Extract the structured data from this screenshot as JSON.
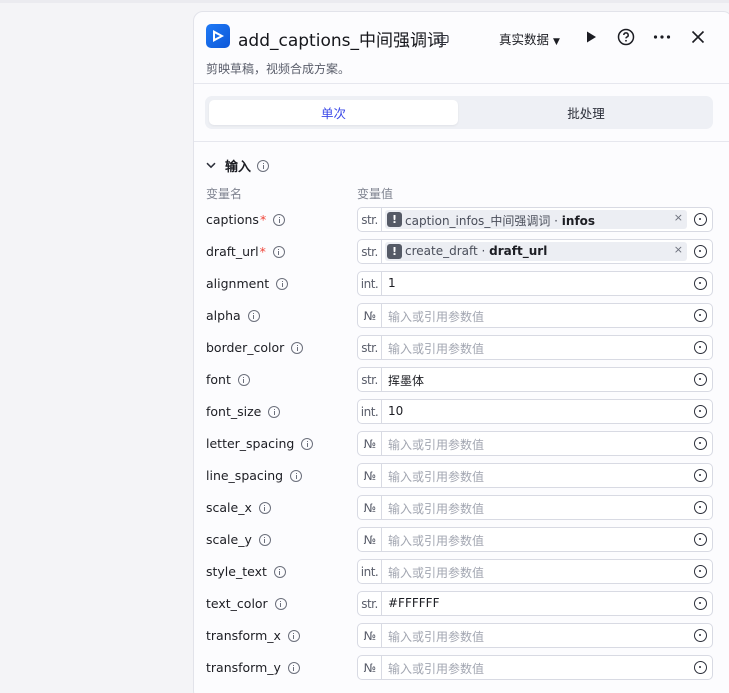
{
  "header": {
    "title": "add_captions_中间强调词",
    "subtitle": "剪映草稿，视频合成方案。",
    "data_mode": "真实数据"
  },
  "tabs": [
    {
      "label": "单次",
      "active": true
    },
    {
      "label": "批处理",
      "active": false
    }
  ],
  "section": {
    "title": "输入",
    "col_name": "变量名",
    "col_value": "变量值"
  },
  "params": [
    {
      "name": "captions",
      "required": true,
      "type": "str.",
      "ref_source": "caption_infos_中间强调词",
      "ref_field": "infos",
      "value": "",
      "placeholder": ""
    },
    {
      "name": "draft_url",
      "required": true,
      "type": "str.",
      "ref_source": "create_draft",
      "ref_field": "draft_url",
      "value": "",
      "placeholder": ""
    },
    {
      "name": "alignment",
      "required": false,
      "type": "int.",
      "value": "1",
      "placeholder": ""
    },
    {
      "name": "alpha",
      "required": false,
      "type": "№",
      "value": "",
      "placeholder": "输入或引用参数值"
    },
    {
      "name": "border_color",
      "required": false,
      "type": "str.",
      "value": "",
      "placeholder": "输入或引用参数值"
    },
    {
      "name": "font",
      "required": false,
      "type": "str.",
      "value": "挥墨体",
      "placeholder": ""
    },
    {
      "name": "font_size",
      "required": false,
      "type": "int.",
      "value": "10",
      "placeholder": ""
    },
    {
      "name": "letter_spacing",
      "required": false,
      "type": "№",
      "value": "",
      "placeholder": "输入或引用参数值"
    },
    {
      "name": "line_spacing",
      "required": false,
      "type": "№",
      "value": "",
      "placeholder": "输入或引用参数值"
    },
    {
      "name": "scale_x",
      "required": false,
      "type": "№",
      "value": "",
      "placeholder": "输入或引用参数值"
    },
    {
      "name": "scale_y",
      "required": false,
      "type": "№",
      "value": "",
      "placeholder": "输入或引用参数值"
    },
    {
      "name": "style_text",
      "required": false,
      "type": "int.",
      "value": "",
      "placeholder": "输入或引用参数值"
    },
    {
      "name": "text_color",
      "required": false,
      "type": "str.",
      "value": "#FFFFFF",
      "placeholder": ""
    },
    {
      "name": "transform_x",
      "required": false,
      "type": "№",
      "value": "",
      "placeholder": "输入或引用参数值"
    },
    {
      "name": "transform_y",
      "required": false,
      "type": "№",
      "value": "",
      "placeholder": "输入或引用参数值"
    }
  ],
  "icons": {
    "app": "capcut-play-icon",
    "title_badge": "node-badge-icon",
    "run": "play-icon",
    "help": "help-icon",
    "more": "more-icon",
    "close": "close-icon",
    "collapse": "chevron-down-icon",
    "info": "info-icon",
    "picker": "variable-picker-icon",
    "clear": "clear-icon",
    "warning": "warning-icon"
  },
  "colors": {
    "accent": "#3a48e8",
    "required": "#f04438",
    "app_icon": "#1f7af6"
  }
}
